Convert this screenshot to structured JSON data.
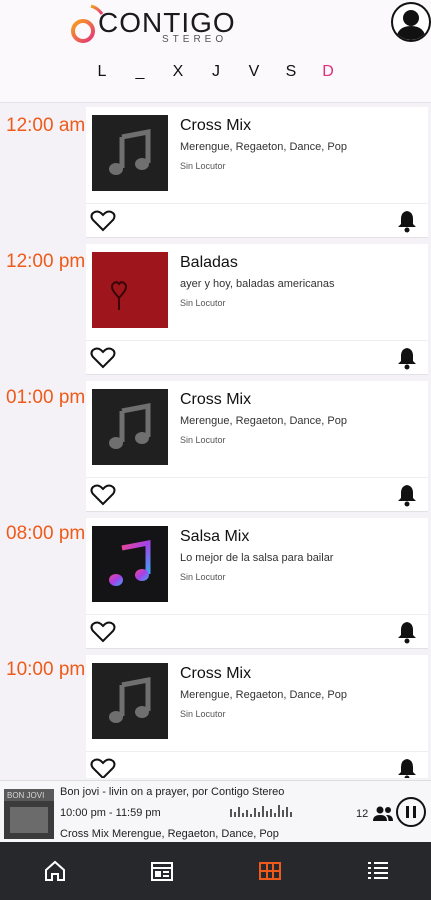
{
  "header": {
    "logo_text": "CONTIGO",
    "logo_sub": "STEREO",
    "brand_color": "#ef5a1a",
    "active_day_color": "#e22d7a",
    "days": [
      {
        "label": "L",
        "active": false
      },
      {
        "label": "_",
        "active": false
      },
      {
        "label": "X",
        "active": false
      },
      {
        "label": "J",
        "active": false
      },
      {
        "label": "V",
        "active": false
      },
      {
        "label": "S",
        "active": false
      },
      {
        "label": "D",
        "active": true
      }
    ]
  },
  "schedule": [
    {
      "time": "12:00 am",
      "title": "Cross Mix",
      "description": "Merengue, Regaeton, Dance, Pop",
      "host": "Sin Locutor",
      "art": "music-note-gray-icon"
    },
    {
      "time": "12:00 pm",
      "title": "Baladas",
      "description": "ayer y hoy, baladas americanas",
      "host": "Sin Locutor",
      "art": "red-heart-lock-artwork"
    },
    {
      "time": "01:00 pm",
      "title": "Cross Mix",
      "description": "Merengue, Regaeton, Dance, Pop",
      "host": "Sin Locutor",
      "art": "music-note-gray-icon"
    },
    {
      "time": "08:00 pm",
      "title": "Salsa Mix",
      "description": "Lo mejor de la salsa para bailar",
      "host": "Sin Locutor",
      "art": "music-note-gradient-icon"
    },
    {
      "time": "10:00 pm",
      "title": "Cross Mix",
      "description": "Merengue, Regaeton, Dance, Pop",
      "host": "Sin Locutor",
      "art": "music-note-gray-icon"
    }
  ],
  "player": {
    "now_playing": "Bon jovi  -  livin on a prayer, por Contigo Stereo",
    "time_range": "10:00 pm - 11:59 pm",
    "show_line": "Cross Mix  Merengue, Regaeton, Dance, Pop",
    "listeners": "12",
    "album_text": "BON JOVI"
  },
  "nav": {
    "items": [
      "home-icon",
      "news-icon",
      "schedule-grid-icon",
      "playlist-icon"
    ],
    "active_color": "#ef5a1a",
    "icon_color": "#ffffff"
  }
}
